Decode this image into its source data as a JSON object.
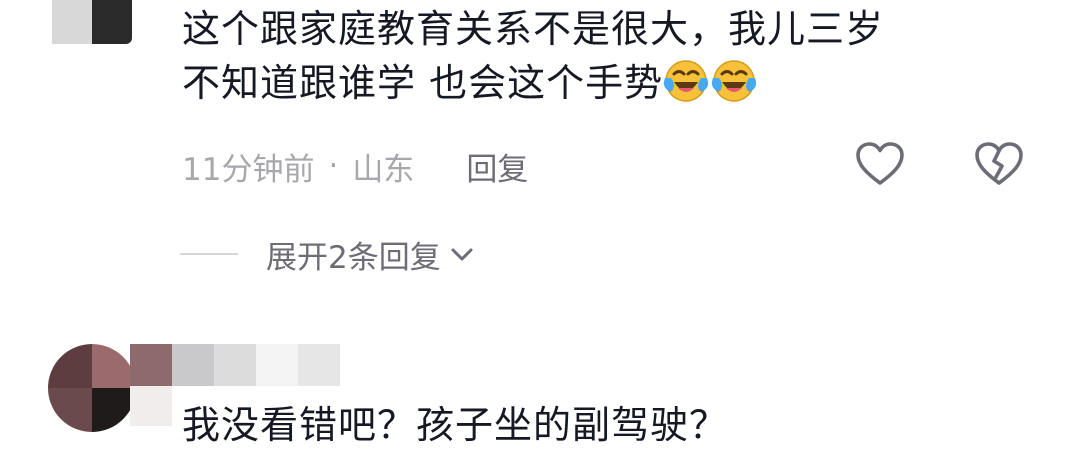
{
  "comment1": {
    "text_line1": "这个跟家庭教育关系不是很大，我儿三岁",
    "text_line2": "不知道跟谁学 也会这个手势",
    "emojis": [
      "laughing-crying-emoji",
      "laughing-crying-emoji"
    ],
    "time": "11分钟前",
    "dot": "·",
    "location": "山东",
    "reply_label": "回复",
    "like_icon": "heart-outline-icon",
    "dislike_icon": "broken-heart-icon",
    "expand_label": "展开2条回复",
    "expand_icon": "chevron-down-icon"
  },
  "comment2": {
    "text": "我没看错吧？孩子坐的副驾驶？"
  },
  "colors": {
    "text_primary": "#161823",
    "text_meta": "#a8a8ac",
    "text_secondary": "#6d6e75",
    "icon": "#6d6e75",
    "emoji_face": "#f7c23a"
  }
}
